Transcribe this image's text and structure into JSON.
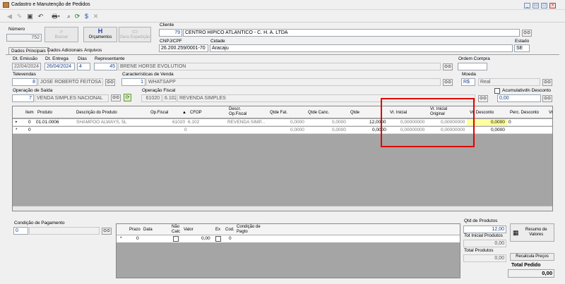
{
  "window": {
    "title": "Cadastro e Manutenção de Pedidos"
  },
  "header": {
    "numero_label": "Número",
    "numero": "752",
    "buscar": "Buscar",
    "orcamentos": "Orçamentos",
    "gera_expedicao": "Gera Expedição",
    "cliente_label": "Cliente",
    "cliente_code": "79",
    "cliente_name": "CENTRO HIPICO ATLANTICO - C. H. A. LTDA",
    "cnpj_label": "CNPJ/CPF",
    "cnpj": "26.200.259/0001-70",
    "cidade_label": "Cidade",
    "cidade": "Aracaju",
    "estado_label": "Estado",
    "estado": "SE"
  },
  "tabs": [
    "Dados Principais",
    "Dados Adicionais",
    "Arquivos"
  ],
  "form": {
    "dt_emissao_label": "Dt. Emissão",
    "dt_emissao": "22/04/2024",
    "dt_entrega_label": "Dt. Entrega",
    "dt_entrega": "26/04/2024",
    "dias_label": "Dias",
    "dias": "4",
    "representante_label": "Representante",
    "representante_code": "45",
    "representante_name": "BRENE HORSE EVOLUTION",
    "ordem_compra_label": "Ordem Compra",
    "ordem_compra": "",
    "televendas_label": "Televendas",
    "televendas_code": "8",
    "televendas_name": "JOSE ROBERTO FEITOSA",
    "caracteristicas_label": "Características de Venda",
    "caracteristicas_code": "1",
    "caracteristicas_name": "WHATSAPP",
    "moeda_label": "Moeda",
    "moeda_code": "R$",
    "moeda_name": "Real",
    "operacao_saida_label": "Operação de Saída",
    "operacao_saida_code": "7",
    "operacao_saida_name": "VENDA SIMPLES NACIONAL",
    "operacao_fiscal_label": "Operação Fiscal",
    "operacao_fiscal_code": "61020",
    "operacao_fiscal_cfop": "6.102",
    "operacao_fiscal_name": "REVENDA SIMPLES",
    "acumulativo_label": "Acumulativo",
    "perc_desconto_label": "% Desconto",
    "perc_desconto": "0,00"
  },
  "items_grid": {
    "headers": [
      "Item",
      "Produto",
      "Descrição do Produto",
      "Op.Fiscal",
      "CFOP",
      "Descr. Op.Fiscal",
      "Qtde Fat.",
      "Qtde Canc.",
      "Qtde",
      "Vr. Inicial",
      "Vr. Inicial Original",
      "Vr. Desconto",
      "Perc. Desconto",
      "Vr"
    ],
    "rows": [
      {
        "marker": "▸",
        "item": "0",
        "produto": "01.01.0006",
        "descricao": "SHAMPOO ALWAYS, 5L",
        "op_fiscal": "61020",
        "cfop": "6.102",
        "descr_op": "REVENDA SIMP...",
        "qtde_fat": "0,0000",
        "qtde_canc": "0,0000",
        "qtde": "12,0000",
        "vr_inicial": "0,00000000",
        "vr_inicial_orig": "0,00000000",
        "vr_desconto": "0,0000",
        "perc_desconto": "0"
      },
      {
        "marker": "*",
        "item": "0",
        "produto": "",
        "descricao": "",
        "op_fiscal": "0",
        "cfop": "",
        "descr_op": "",
        "qtde_fat": "0,0000",
        "qtde_canc": "0,0000",
        "qtde": "0,0000",
        "vr_inicial": "0,00000000",
        "vr_inicial_orig": "0,00000000",
        "vr_desconto": "0,0000",
        "perc_desconto": ""
      }
    ]
  },
  "payment": {
    "condicao_label": "Condição de Pagamento",
    "condicao_code": "0",
    "headers": [
      "Prazo",
      "Data",
      "Não Calc",
      "Valor",
      "Ex",
      "Cod.",
      "Condição de Pagto"
    ],
    "row": {
      "marker": "*",
      "prazo": "0",
      "data": "",
      "valor": "0,00",
      "cod": "0"
    }
  },
  "totals": {
    "qtd_produtos_label": "Qtd de Produtos",
    "qtd_produtos": "12,00",
    "tot_inicial_label": "Tot Inicial Produtos",
    "tot_inicial": "0,00",
    "total_produtos_label": "Total Produtos",
    "total_produtos": "0,00",
    "resumo_valores": "Resumo de Valores",
    "recalcula_precos": "Recalcula Preços",
    "total_pedido_label": "Total Pedido",
    "total_pedido": "0,00"
  },
  "colors": {
    "highlight_box": "#e00000",
    "input_text": "#1a3f8c"
  }
}
